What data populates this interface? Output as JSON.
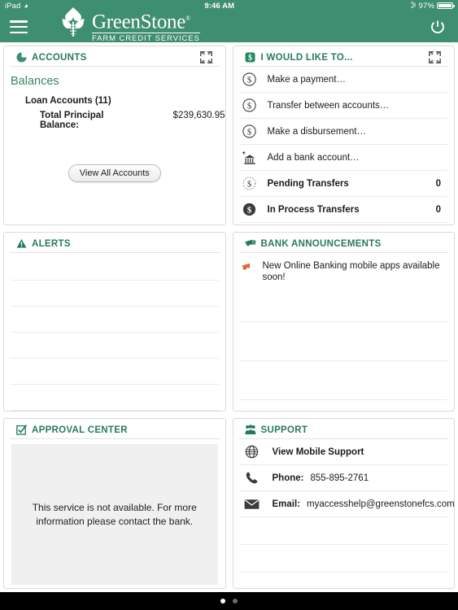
{
  "statusbar": {
    "device": "iPad",
    "wifi_icon": "wifi-icon",
    "time": "9:46 AM",
    "bluetooth_icon": "bluetooth-icon",
    "battery_percent": "97%"
  },
  "navbar": {
    "menu_icon": "hamburger-menu-icon",
    "logo_mark_icon": "greenstone-leaf-logo-icon",
    "brand_name": "GreenStone",
    "brand_registered": "®",
    "brand_tagline": "FARM CREDIT SERVICES",
    "refresh_icon": "refresh-icon",
    "header_color": "#3e8e70"
  },
  "panels": {
    "accounts": {
      "title": "ACCOUNTS",
      "icon": "pie-chart-icon",
      "expand_icon": "expand-fullscreen-icon",
      "section_title": "Balances",
      "loan_accounts_label": "Loan Accounts (11)",
      "balance_label": "Total Principal Balance:",
      "balance_value": "$239,630.95",
      "view_all_button": "View All Accounts"
    },
    "i_would_like_to": {
      "title": "I WOULD LIKE TO...",
      "icon": "dollar-rounded-square-icon",
      "expand_icon": "expand-fullscreen-icon",
      "items": [
        {
          "label": "Make a payment…",
          "icon": "dollar-circle-outline-icon",
          "count": ""
        },
        {
          "label": "Transfer between accounts…",
          "icon": "dollar-circle-outline-icon",
          "count": ""
        },
        {
          "label": "Make a disbursement…",
          "icon": "dollar-circle-outline-icon",
          "count": ""
        },
        {
          "label": "Add a bank account…",
          "icon": "bank-plus-icon",
          "count": ""
        },
        {
          "label": "Pending Transfers",
          "icon": "dollar-circle-dashed-icon",
          "count": "0"
        },
        {
          "label": "In Process Transfers",
          "icon": "dollar-circle-filled-icon",
          "count": "0"
        }
      ]
    },
    "alerts": {
      "title": "ALERTS",
      "icon": "warning-triangle-icon",
      "items": []
    },
    "bank_announcements": {
      "title": "BANK ANNOUNCEMENTS",
      "icon": "megaphone-icon",
      "items": [
        {
          "text": "New Online Banking mobile apps available soon!",
          "icon": "megaphone-orange-icon"
        }
      ]
    },
    "approval_center": {
      "title": "APPROVAL CENTER",
      "icon": "checkbox-checked-icon",
      "message": "This service is not available. For more information please contact the bank."
    },
    "support": {
      "title": "SUPPORT",
      "icon": "support-people-icon",
      "rows": [
        {
          "icon": "globe-icon",
          "label": "View Mobile Support",
          "value": ""
        },
        {
          "icon": "phone-icon",
          "label": "Phone:",
          "value": "855-895-2761"
        },
        {
          "icon": "envelope-icon",
          "label": "Email:",
          "value": "myaccesshelp@greenstonefcs.com"
        }
      ]
    }
  },
  "bottombar": {
    "page_dots": 2,
    "active_dot": 1
  },
  "colors": {
    "brand_green": "#3e8e70",
    "panel_title_green": "#2a7a5e",
    "accent_orange": "#e8622a"
  }
}
